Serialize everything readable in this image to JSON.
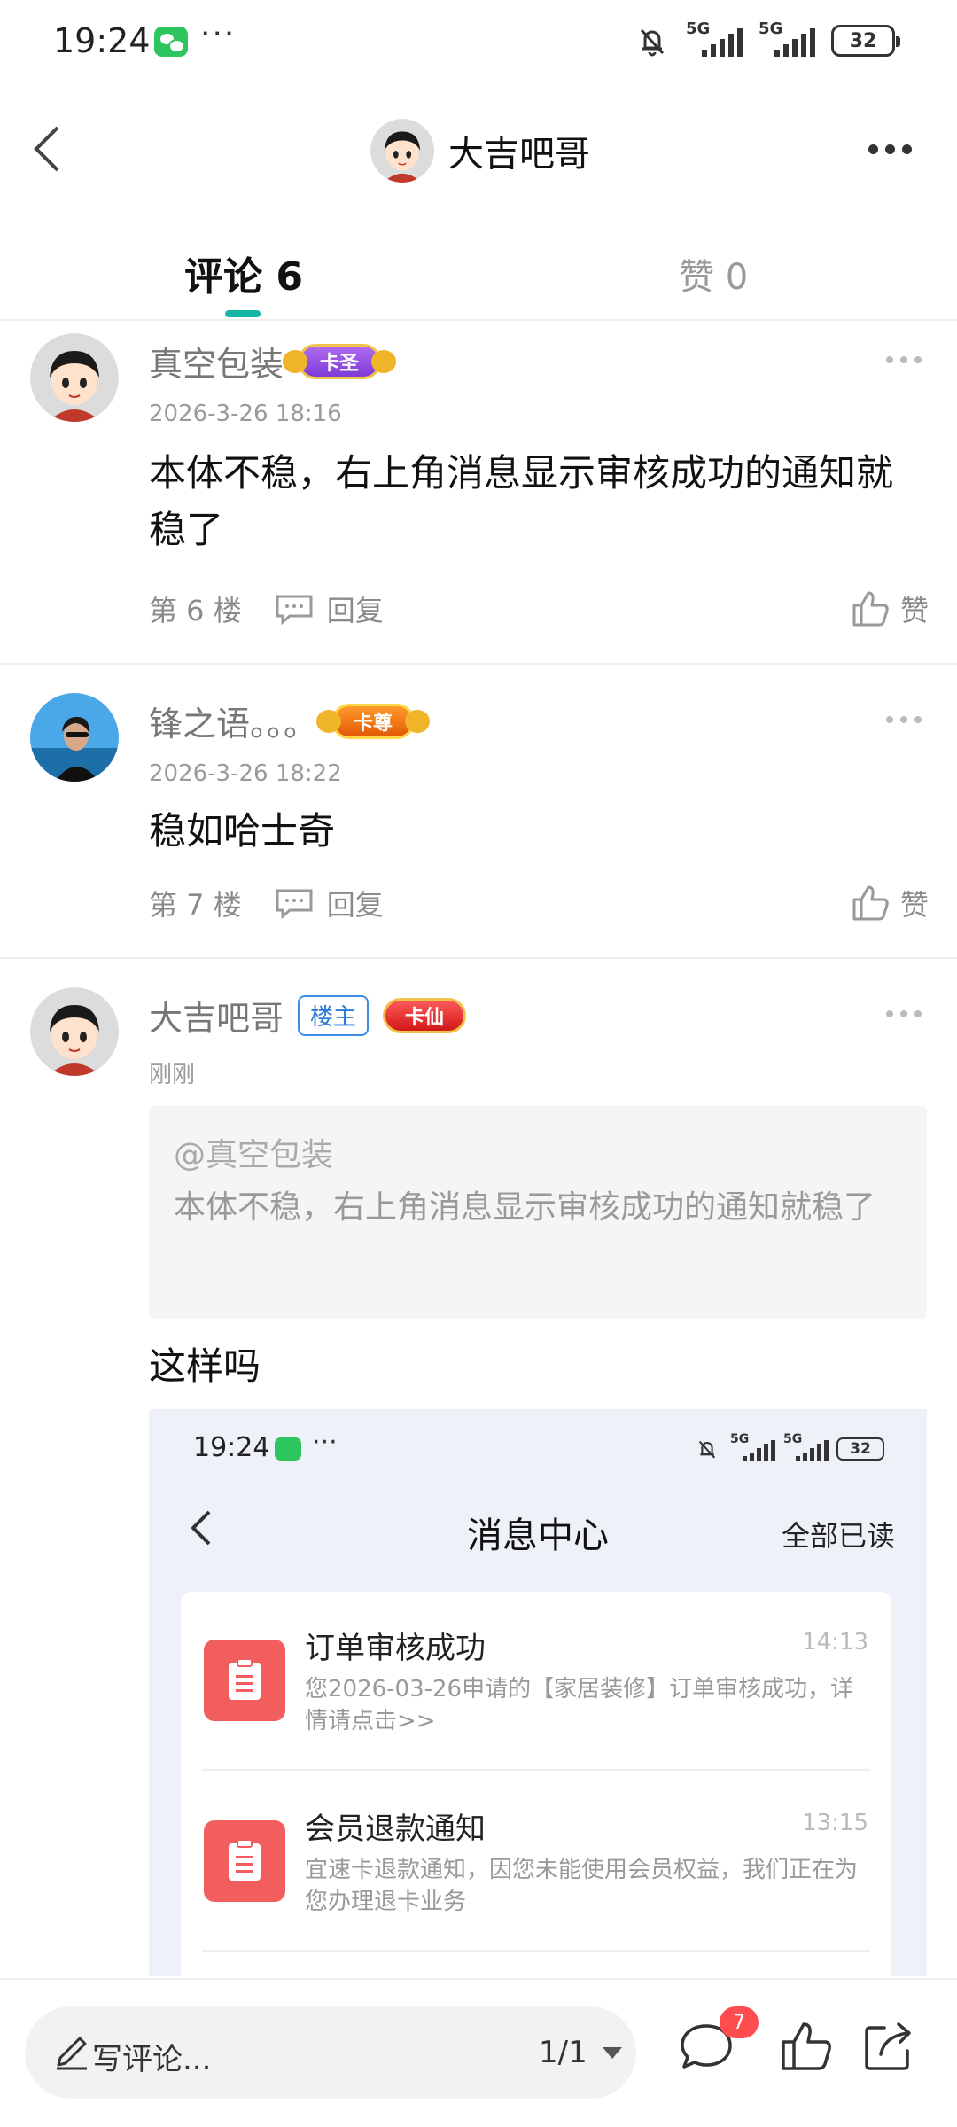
{
  "status_bar": {
    "time": "19:24",
    "net1": "5G",
    "net2": "5G",
    "battery": "32"
  },
  "header": {
    "title": "大吉吧哥"
  },
  "tabs": {
    "comments": "评论 6",
    "likes": "赞 0"
  },
  "comments": [
    {
      "name": "真空包装",
      "badge": "卡圣",
      "time": "2026-3-26 18:16",
      "text": "本体不稳，右上角消息显示审核成功的通知就稳了",
      "floor": "第 6 楼",
      "reply": "回复",
      "like": "赞"
    },
    {
      "name": "锋之语。。。",
      "badge": "卡尊",
      "time": "2026-3-26 18:22",
      "text": "稳如哈士奇",
      "floor": "第 7 楼",
      "reply": "回复",
      "like": "赞"
    },
    {
      "name": "大吉吧哥",
      "tag": "楼主",
      "badge": "卡仙",
      "time": "刚刚",
      "quote_at": "@真空包装",
      "quote_text": "本体不稳，右上角消息显示审核成功的通知就稳了",
      "text": "这样吗"
    }
  ],
  "embedded_screenshot": {
    "status_time": "19:24",
    "net1": "5G",
    "net2": "5G",
    "battery": "32",
    "title": "消息中心",
    "read_all": "全部已读",
    "messages": [
      {
        "title": "订单审核成功",
        "time": "14:13",
        "body": "您2026-03-26申请的【家居装修】订单审核成功，详情请点击>>"
      },
      {
        "title": "会员退款通知",
        "time": "13:15",
        "body": "宜速卡退款通知，因您未能使用会员权益，我们正在为您办理退卡业务"
      }
    ]
  },
  "bottom_bar": {
    "placeholder": "写评论...",
    "page": "1/1",
    "comment_badge": "7"
  },
  "colors": {
    "accent": "#16b6a5",
    "badge_red": "#ff4d4f",
    "message_icon": "#f25e5e",
    "louzhu_blue": "#2a7ad8"
  }
}
